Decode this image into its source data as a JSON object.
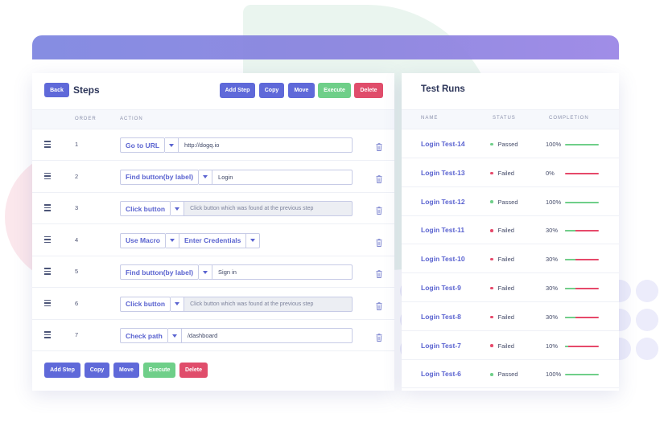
{
  "steps": {
    "back_label": "Back",
    "title": "Steps",
    "top_actions": [
      "Add Step",
      "Copy",
      "Move",
      "Execute",
      "Delete"
    ],
    "bottom_actions": [
      "Add Step",
      "Copy",
      "Move",
      "Execute",
      "Delete"
    ],
    "columns": {
      "order": "ORDER",
      "action": "ACTION"
    },
    "rows": [
      {
        "order": "1",
        "action": "Go to URL",
        "value": "http://dogq.io",
        "disabled": false
      },
      {
        "order": "2",
        "action": "Find button(by label)",
        "value": "Login",
        "disabled": false
      },
      {
        "order": "3",
        "action": "Click button",
        "value": "Click button which was found at the previous step",
        "disabled": true
      },
      {
        "order": "4",
        "action": "Use Macro",
        "macro": "Enter Credentials"
      },
      {
        "order": "5",
        "action": "Find button(by label)",
        "value": "Sign in",
        "disabled": false
      },
      {
        "order": "6",
        "action": "Click button",
        "value": "Click button which was found at the previous step",
        "disabled": true
      },
      {
        "order": "7",
        "action": "Check path",
        "value": "/dashboard",
        "disabled": false
      }
    ]
  },
  "runs": {
    "title": "Test Runs",
    "columns": {
      "name": "NAME",
      "status": "STATUS",
      "completion": "COMPLETION"
    },
    "rows": [
      {
        "name": "Login Test-14",
        "status": "Passed",
        "completion": "100%",
        "fraction": 1.0
      },
      {
        "name": "Login Test-13",
        "status": "Failed",
        "completion": "0%",
        "fraction": 0.0
      },
      {
        "name": "Login Test-12",
        "status": "Passed",
        "completion": "100%",
        "fraction": 1.0
      },
      {
        "name": "Login Test-11",
        "status": "Failed",
        "completion": "30%",
        "fraction": 0.3
      },
      {
        "name": "Login Test-10",
        "status": "Failed",
        "completion": "30%",
        "fraction": 0.3
      },
      {
        "name": "Login Test-9",
        "status": "Failed",
        "completion": "30%",
        "fraction": 0.3
      },
      {
        "name": "Login Test-8",
        "status": "Failed",
        "completion": "30%",
        "fraction": 0.3
      },
      {
        "name": "Login Test-7",
        "status": "Failed",
        "completion": "10%",
        "fraction": 0.1
      },
      {
        "name": "Login Test-6",
        "status": "Passed",
        "completion": "100%",
        "fraction": 1.0
      }
    ]
  },
  "colors": {
    "accent": "#5f69d9",
    "execute": "#6fcf89",
    "delete": "#e04d6b",
    "passed": "#6fcf89",
    "failed": "#e6496a"
  },
  "icons": {
    "drag": "drag-handle-icon",
    "trash": "trash-icon",
    "dropdown": "caret-down-icon"
  }
}
